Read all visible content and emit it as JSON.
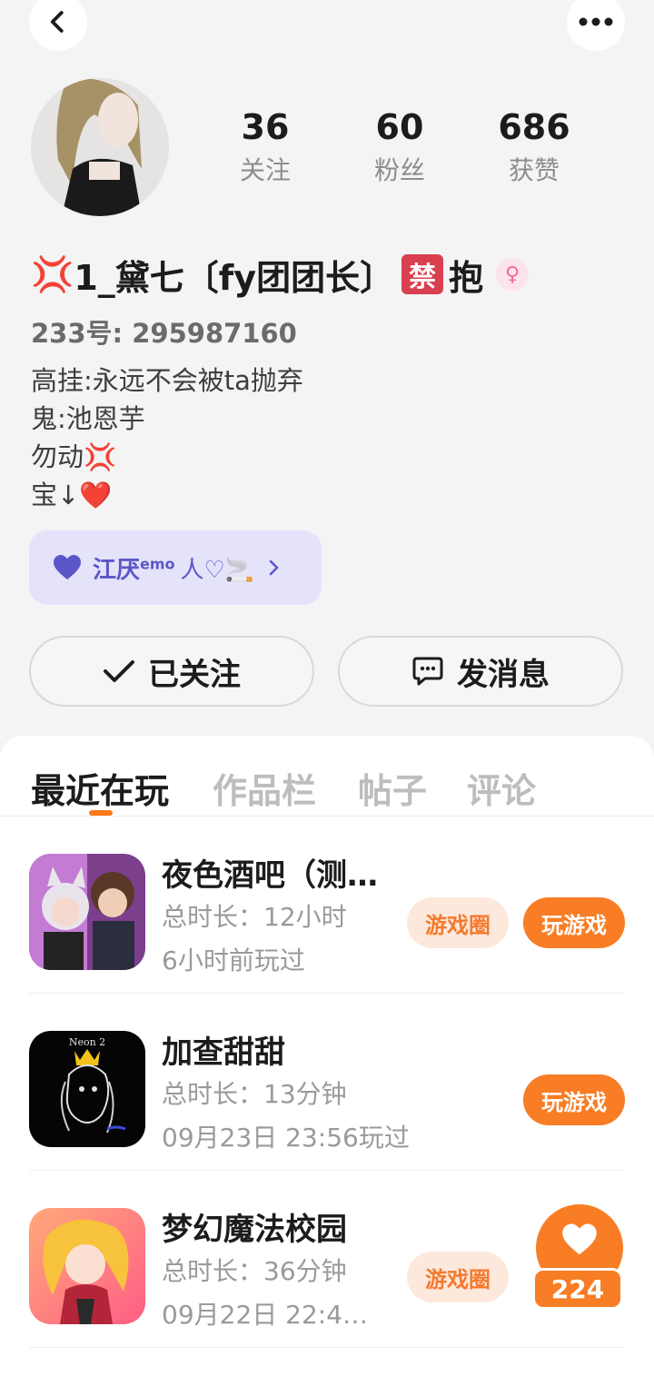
{
  "header": {
    "back_icon": "chevron-left-icon",
    "more_icon": "more-dots-icon"
  },
  "profile": {
    "stats": [
      {
        "value": "36",
        "label": "关注"
      },
      {
        "value": "60",
        "label": "粉丝"
      },
      {
        "value": "686",
        "label": "获赞"
      }
    ],
    "nickname_prefix": "💢",
    "nickname": "1_黛七〔fy团团长〕",
    "ban_badge": "禁",
    "nickname_suffix": "抱",
    "gender_icon": "♀",
    "uid": "233号: 295987160",
    "bio": [
      "高挂:永远不会被ta抛弃",
      "鬼:池恩芋",
      "勿动💢",
      "宝↓❤️"
    ],
    "tag": {
      "text": "江厌",
      "sup": "emo",
      "extra": "人♡🚬"
    }
  },
  "actions": {
    "follow_label": "已关注",
    "message_label": "发消息"
  },
  "tabs": [
    {
      "label": "最近在玩",
      "active": true
    },
    {
      "label": "作品栏",
      "active": false
    },
    {
      "label": "帖子",
      "active": false
    },
    {
      "label": "评论",
      "active": false
    }
  ],
  "games": [
    {
      "title": "夜色酒吧（测…",
      "duration": "总时长：12小时",
      "last_played": "6小时前玩过",
      "circle_label": "游戏圈",
      "play_label": "玩游戏"
    },
    {
      "title": "加查甜甜",
      "duration": "总时长：13分钟",
      "last_played": "09月23日 23:56玩过",
      "play_label": "玩游戏",
      "icon_text": "Neon 2"
    },
    {
      "title": "梦幻魔法校园",
      "duration": "总时长：36分钟",
      "last_played": "09月22日 22:4…",
      "circle_label": "游戏圈"
    }
  ],
  "like_float": {
    "count": "224"
  },
  "colors": {
    "accent": "#f87d24",
    "tag_bg": "#e4e3fa",
    "tag_text": "#5b57c8"
  }
}
